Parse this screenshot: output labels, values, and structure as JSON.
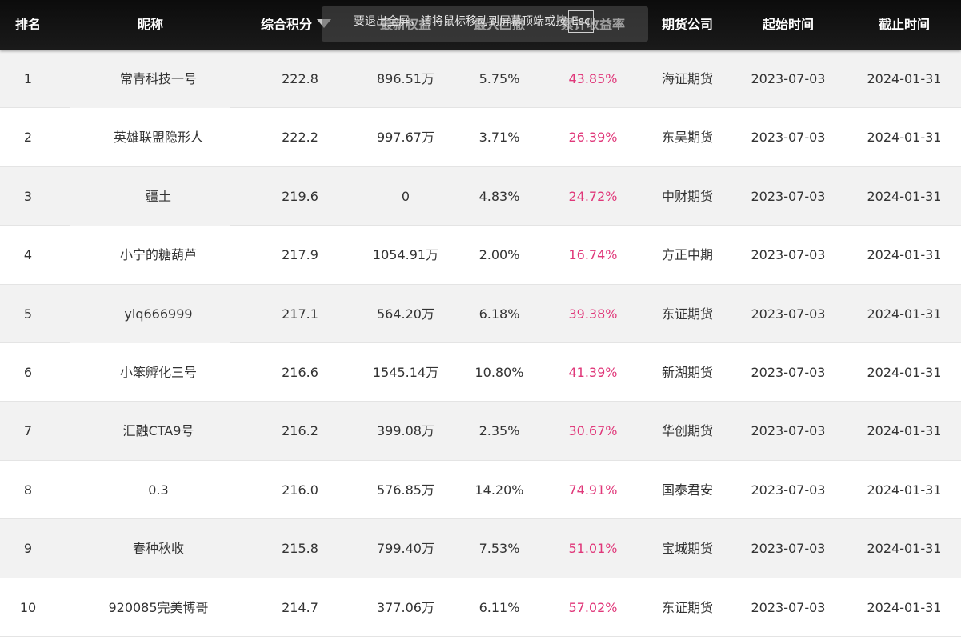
{
  "header": {
    "rank": "排名",
    "nickname": "昵称",
    "score": "综合积分",
    "latest_equity": "最新权益",
    "max_drawdown": "最大回撤",
    "cumulative_return": "累计收益率",
    "futures_company": "期货公司",
    "start_time": "起始时间",
    "end_time": "截止时间"
  },
  "toast": {
    "text_before": "要退出全屏，请将鼠标移动到屏幕顶端或按",
    "key": "Esc",
    "text_after": ""
  },
  "colors": {
    "header_bg": "#111111",
    "row_odd": "#f2f2f2",
    "row_even": "#ffffff",
    "rate": "#e0387a",
    "text": "#333333"
  },
  "rows": [
    {
      "rank": "1",
      "nickname": "常青科技一号",
      "score": "222.8",
      "equity": "896.51万",
      "drawdown": "5.75%",
      "rate": "43.85%",
      "company": "海证期货",
      "start": "2023-07-03",
      "end": "2024-01-31"
    },
    {
      "rank": "2",
      "nickname": "英雄联盟隐形人",
      "score": "222.2",
      "equity": "997.67万",
      "drawdown": "3.71%",
      "rate": "26.39%",
      "company": "东吴期货",
      "start": "2023-07-03",
      "end": "2024-01-31"
    },
    {
      "rank": "3",
      "nickname": "疆土",
      "score": "219.6",
      "equity": "0",
      "drawdown": "4.83%",
      "rate": "24.72%",
      "company": "中财期货",
      "start": "2023-07-03",
      "end": "2024-01-31"
    },
    {
      "rank": "4",
      "nickname": "小宁的糖葫芦",
      "score": "217.9",
      "equity": "1054.91万",
      "drawdown": "2.00%",
      "rate": "16.74%",
      "company": "方正中期",
      "start": "2023-07-03",
      "end": "2024-01-31"
    },
    {
      "rank": "5",
      "nickname": "ylq666999",
      "score": "217.1",
      "equity": "564.20万",
      "drawdown": "6.18%",
      "rate": "39.38%",
      "company": "东证期货",
      "start": "2023-07-03",
      "end": "2024-01-31"
    },
    {
      "rank": "6",
      "nickname": "小笨孵化三号",
      "score": "216.6",
      "equity": "1545.14万",
      "drawdown": "10.80%",
      "rate": "41.39%",
      "company": "新湖期货",
      "start": "2023-07-03",
      "end": "2024-01-31"
    },
    {
      "rank": "7",
      "nickname": "汇融CTA9号",
      "score": "216.2",
      "equity": "399.08万",
      "drawdown": "2.35%",
      "rate": "30.67%",
      "company": "华创期货",
      "start": "2023-07-03",
      "end": "2024-01-31"
    },
    {
      "rank": "8",
      "nickname": "0.3",
      "score": "216.0",
      "equity": "576.85万",
      "drawdown": "14.20%",
      "rate": "74.91%",
      "company": "国泰君安",
      "start": "2023-07-03",
      "end": "2024-01-31"
    },
    {
      "rank": "9",
      "nickname": "春种秋收",
      "score": "215.8",
      "equity": "799.40万",
      "drawdown": "7.53%",
      "rate": "51.01%",
      "company": "宝城期货",
      "start": "2023-07-03",
      "end": "2024-01-31"
    },
    {
      "rank": "10",
      "nickname": "920085完美博哥",
      "score": "214.7",
      "equity": "377.06万",
      "drawdown": "6.11%",
      "rate": "57.02%",
      "company": "东证期货",
      "start": "2023-07-03",
      "end": "2024-01-31"
    }
  ]
}
